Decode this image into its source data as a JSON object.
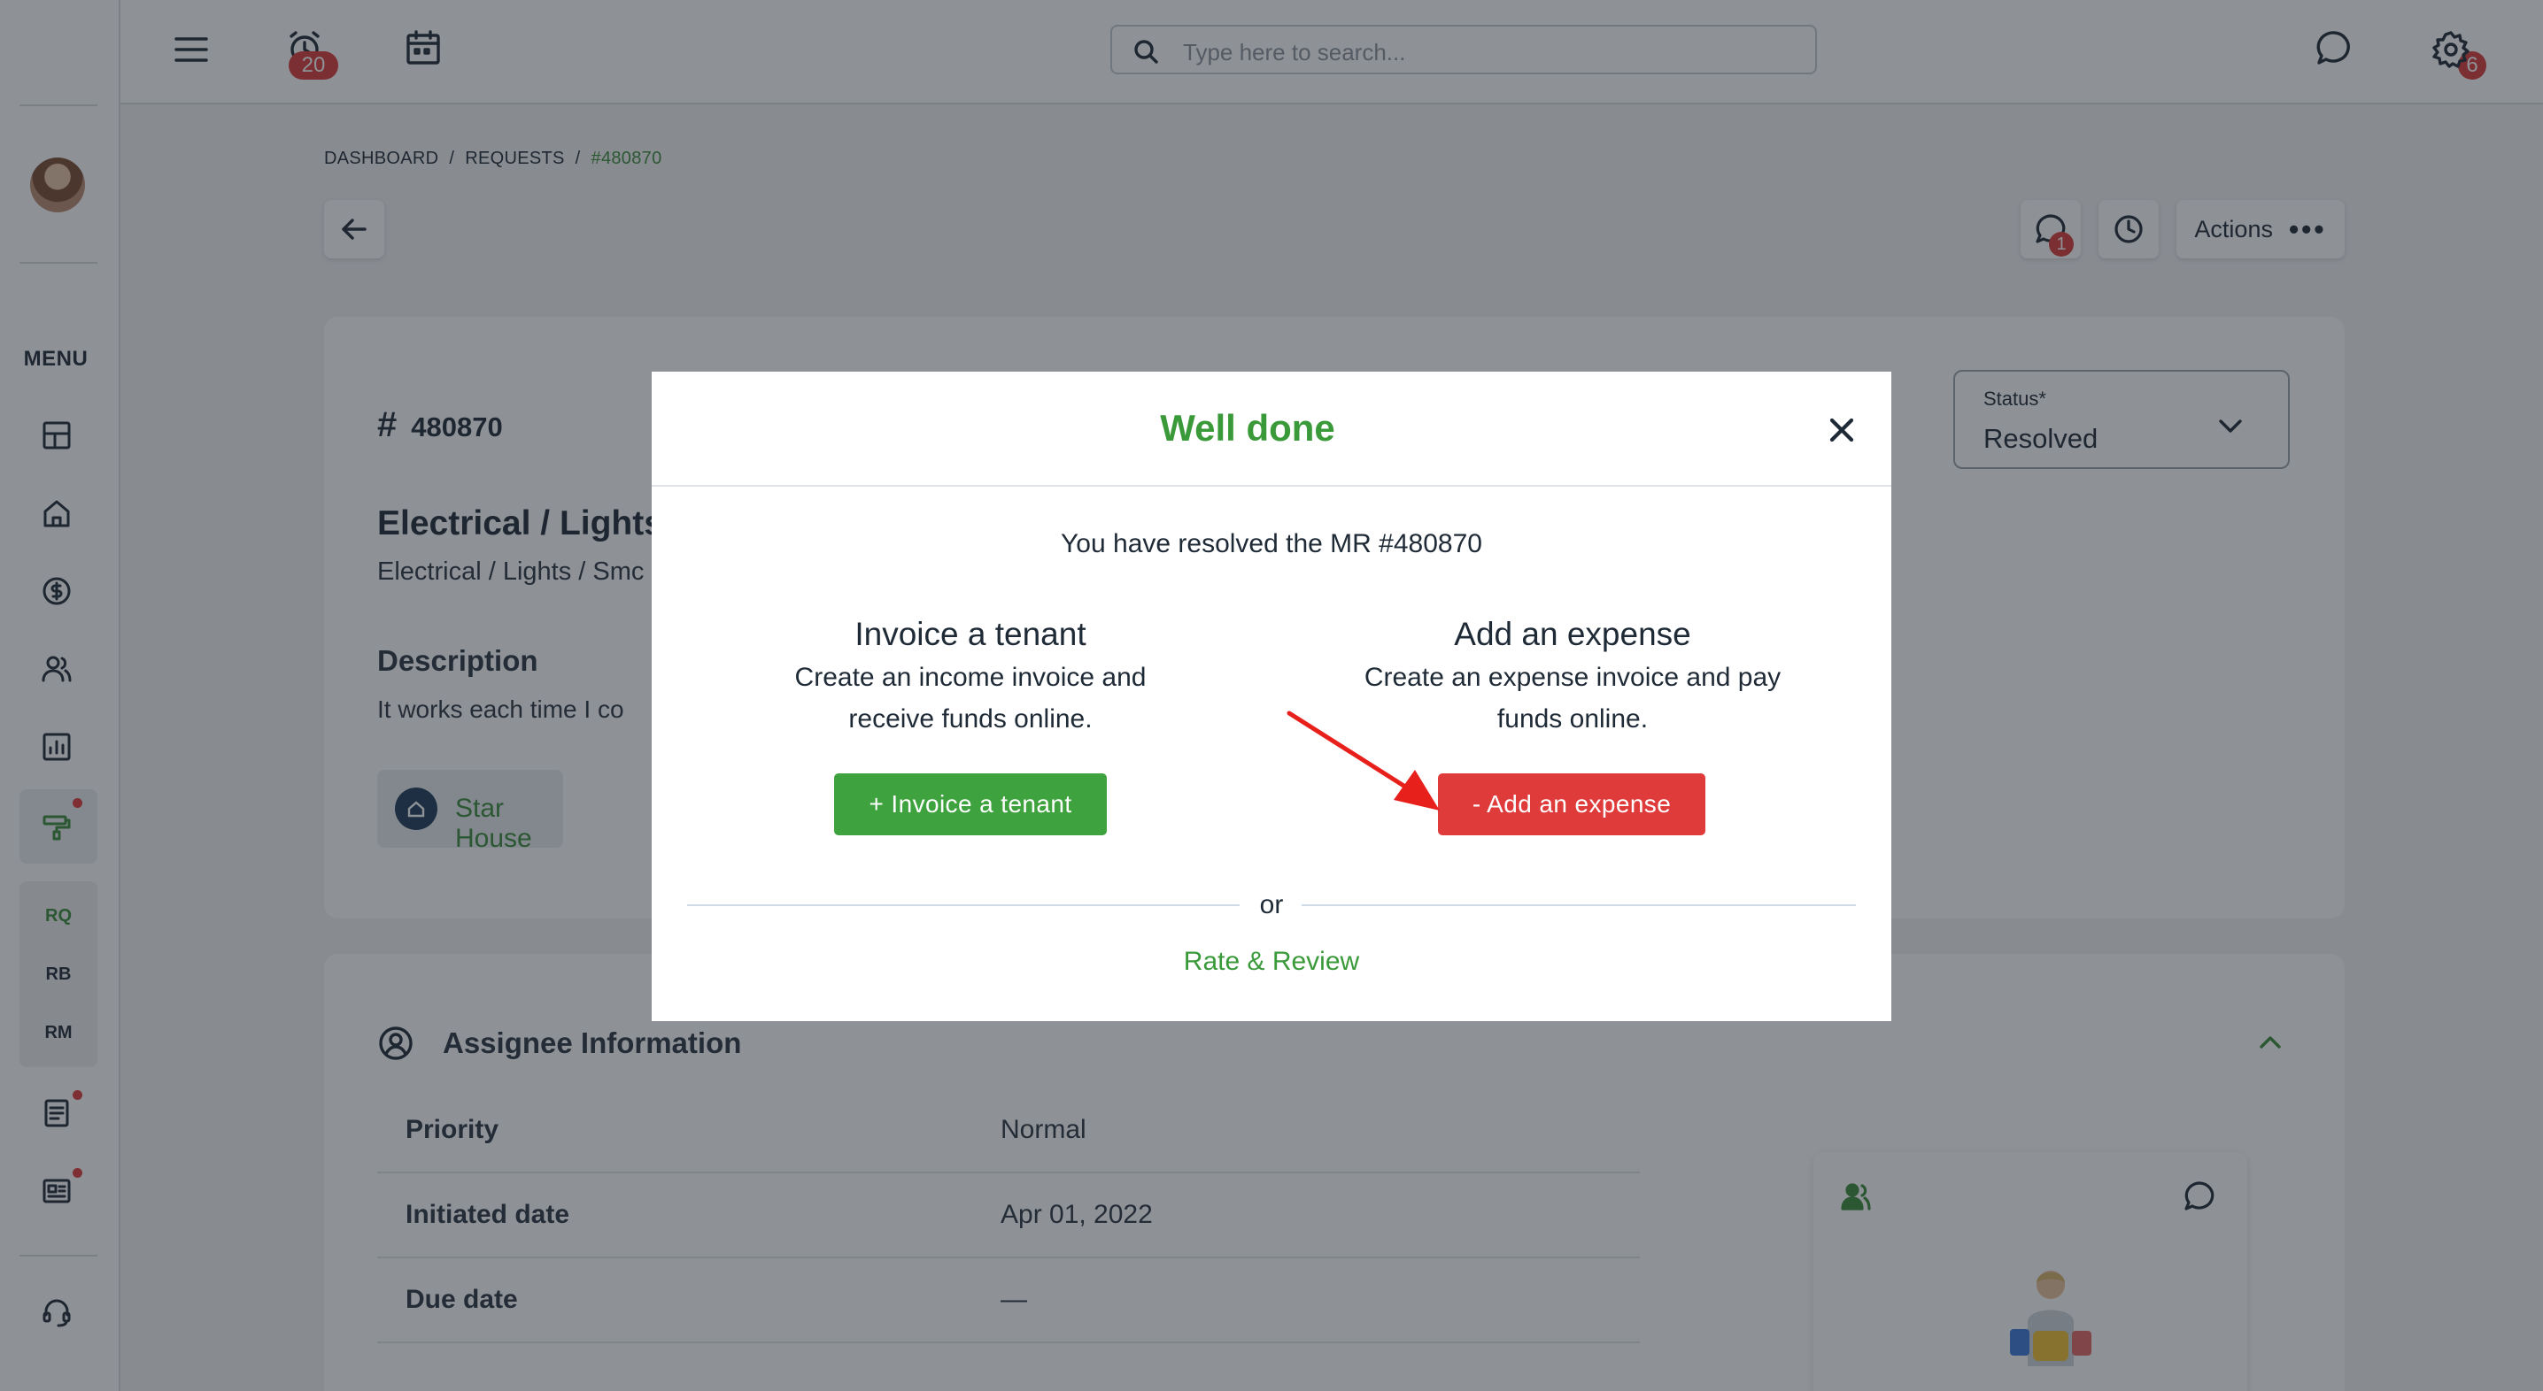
{
  "topbar": {
    "alarm_badge": "20",
    "search_placeholder": "Type here to search...",
    "chat_badge": "6"
  },
  "sidebar": {
    "menu_label": "MENU",
    "subitems": [
      "RQ",
      "RB",
      "RM"
    ]
  },
  "breadcrumb": {
    "items": [
      "DASHBOARD",
      "REQUESTS",
      "#480870"
    ]
  },
  "header": {
    "chat_badge": "1",
    "actions_label": "Actions",
    "actions_dots": "•••"
  },
  "request": {
    "id": "480870",
    "title": "Electrical / Lights",
    "subtitle": "Electrical / Lights / Smc",
    "description_heading": "Description",
    "description_text": "It works each time I co",
    "property": "Star House",
    "status_label": "Status*",
    "status_value": "Resolved"
  },
  "assignee": {
    "heading": "Assignee Information",
    "rows": [
      {
        "key": "Priority",
        "value": "Normal"
      },
      {
        "key": "Initiated date",
        "value": "Apr 01, 2022"
      },
      {
        "key": "Due date",
        "value": "—"
      }
    ]
  },
  "modal": {
    "title": "Well done",
    "message": "You have resolved the MR #480870",
    "invoice_title": "Invoice a tenant",
    "invoice_desc_line1": "Create an income invoice and",
    "invoice_desc_line2": "receive funds online.",
    "invoice_button": "+ Invoice a tenant",
    "expense_title": "Add an expense",
    "expense_desc_line1": "Create an expense invoice and pay",
    "expense_desc_line2": "funds online.",
    "expense_button": "- Add an expense",
    "or_text": "or",
    "rate_link": "Rate & Review"
  },
  "colors": {
    "accent_green": "#3ea23e",
    "danger_red": "#e03b3b",
    "text_dark": "#1f2a37"
  }
}
